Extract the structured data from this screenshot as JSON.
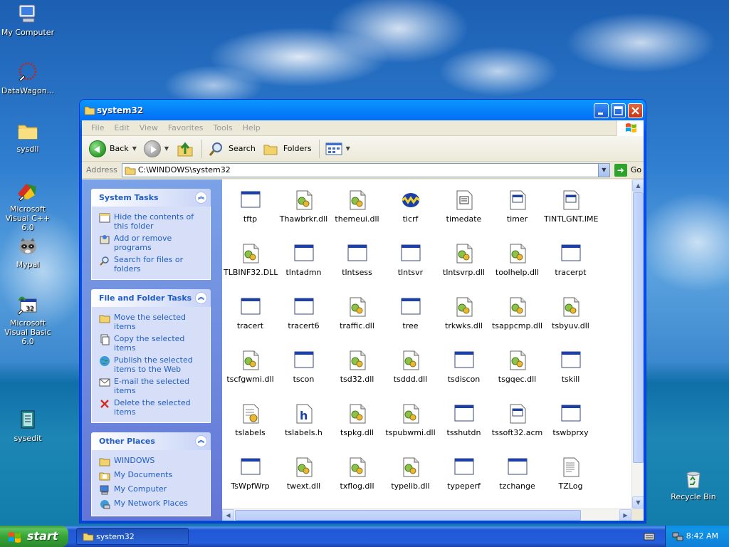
{
  "desktop": {
    "icons": [
      {
        "label": "My Computer"
      },
      {
        "label": "DataWagon..."
      },
      {
        "label": "sysdll"
      },
      {
        "label": "Microsoft Visual C++ 6.0"
      },
      {
        "label": "Mypal"
      },
      {
        "label": "Microsoft Visual Basic 6.0"
      },
      {
        "label": "sysedit"
      },
      {
        "label": "Recycle Bin"
      }
    ]
  },
  "window": {
    "title": "system32",
    "menu": [
      "File",
      "Edit",
      "View",
      "Favorites",
      "Tools",
      "Help"
    ],
    "toolbar": {
      "back": "Back",
      "search": "Search",
      "folders": "Folders"
    },
    "address": {
      "label": "Address",
      "value": "C:\\WINDOWS\\system32",
      "go": "Go"
    }
  },
  "taskpane": {
    "system_tasks": {
      "title": "System Tasks",
      "items": [
        "Hide the contents of this folder",
        "Add or remove programs",
        "Search for files or folders"
      ]
    },
    "file_tasks": {
      "title": "File and Folder Tasks",
      "items": [
        "Move the selected items",
        "Copy the selected items",
        "Publish the selected items to the Web",
        "E-mail the selected items",
        "Delete the selected items"
      ]
    },
    "other_places": {
      "title": "Other Places",
      "items": [
        "WINDOWS",
        "My Documents",
        "My Computer",
        "My Network Places"
      ]
    }
  },
  "files": [
    {
      "name": "tftp",
      "kind": "exe"
    },
    {
      "name": "Thawbrkr.dll",
      "kind": "dll"
    },
    {
      "name": "themeui.dll",
      "kind": "dll"
    },
    {
      "name": "ticrf",
      "kind": "rf"
    },
    {
      "name": "timedate",
      "kind": "cpl"
    },
    {
      "name": "timer",
      "kind": "sys"
    },
    {
      "name": "TINTLGNT.IME",
      "kind": "sys"
    },
    {
      "name": "TLBINF32.DLL",
      "kind": "dll"
    },
    {
      "name": "tlntadmn",
      "kind": "exe"
    },
    {
      "name": "tlntsess",
      "kind": "exe"
    },
    {
      "name": "tlntsvr",
      "kind": "exe"
    },
    {
      "name": "tlntsvrp.dll",
      "kind": "dll"
    },
    {
      "name": "toolhelp.dll",
      "kind": "dll"
    },
    {
      "name": "tracerpt",
      "kind": "exe"
    },
    {
      "name": "tracert",
      "kind": "exe"
    },
    {
      "name": "tracert6",
      "kind": "exe"
    },
    {
      "name": "traffic.dll",
      "kind": "dll"
    },
    {
      "name": "tree",
      "kind": "exe"
    },
    {
      "name": "trkwks.dll",
      "kind": "dll"
    },
    {
      "name": "tsappcmp.dll",
      "kind": "dll"
    },
    {
      "name": "tsbyuv.dll",
      "kind": "dll"
    },
    {
      "name": "tscfgwmi.dll",
      "kind": "dll"
    },
    {
      "name": "tscon",
      "kind": "exe"
    },
    {
      "name": "tsd32.dll",
      "kind": "dll"
    },
    {
      "name": "tsddd.dll",
      "kind": "dll"
    },
    {
      "name": "tsdiscon",
      "kind": "exe"
    },
    {
      "name": "tsgqec.dll",
      "kind": "dll"
    },
    {
      "name": "tskill",
      "kind": "exe"
    },
    {
      "name": "tslabels",
      "kind": "ini"
    },
    {
      "name": "tslabels.h",
      "kind": "h"
    },
    {
      "name": "tspkg.dll",
      "kind": "dll"
    },
    {
      "name": "tspubwmi.dll",
      "kind": "dll"
    },
    {
      "name": "tsshutdn",
      "kind": "exe"
    },
    {
      "name": "tssoft32.acm",
      "kind": "sys"
    },
    {
      "name": "tswbprxy",
      "kind": "exe"
    },
    {
      "name": "TsWpfWrp",
      "kind": "exe"
    },
    {
      "name": "twext.dll",
      "kind": "dll"
    },
    {
      "name": "txflog.dll",
      "kind": "dll"
    },
    {
      "name": "typelib.dll",
      "kind": "dll"
    },
    {
      "name": "typeperf",
      "kind": "exe"
    },
    {
      "name": "tzchange",
      "kind": "exe"
    },
    {
      "name": "TZLog",
      "kind": "txt"
    }
  ],
  "taskbar": {
    "start": "start",
    "task": "system32",
    "clock": "8:42 AM"
  },
  "colors": {
    "accent": "#0053ee",
    "task_link": "#215dc6",
    "start_green": "#37a537"
  }
}
